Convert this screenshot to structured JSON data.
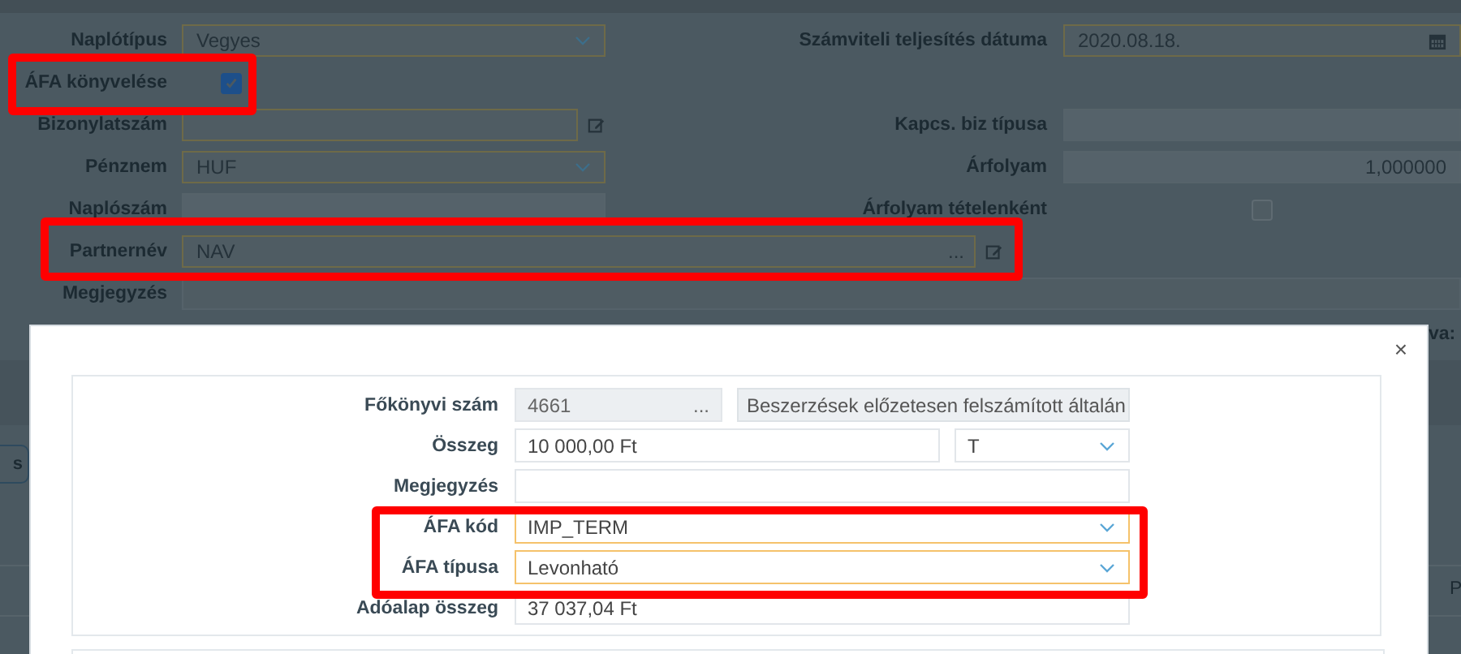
{
  "journal_form": {
    "rows": [
      {
        "left": {
          "label": "Naplótípus",
          "kind": "select",
          "value": "Vegyes"
        },
        "right": {
          "label": "Számviteli teljesítés dátuma",
          "kind": "date",
          "value": "2020.08.18."
        }
      },
      {
        "left": {
          "label": "ÁFA könyvelése",
          "kind": "checkbox",
          "checked": true
        }
      },
      {
        "left": {
          "label": "Bizonylatszám",
          "kind": "text",
          "edit_button": true
        },
        "right": {
          "label": "Kapcs. biz típusa",
          "kind": "readonly"
        }
      },
      {
        "left": {
          "label": "Pénznem",
          "kind": "select",
          "value": "HUF"
        },
        "right": {
          "label": "Árfolyam",
          "kind": "readonly",
          "value": "1,000000"
        }
      },
      {
        "left": {
          "label": "Naplószám",
          "kind": "readonly"
        },
        "right": {
          "label": "Árfolyam tételenként",
          "kind": "checkbox",
          "checked": false
        }
      },
      {
        "left": {
          "label": "Partnernév",
          "kind": "lookup",
          "value": "NAV",
          "ellipsis": "...",
          "edit_button": true
        }
      },
      {
        "left": {
          "label": "Megjegyzés",
          "kind": "note"
        }
      }
    ]
  },
  "background_fragments": {
    "label_fragment": "va:",
    "button_fragment": "s",
    "column_header_fragment": "P"
  },
  "modal": {
    "close": "×",
    "rows": [
      {
        "label": "Főkönyvi szám",
        "kind": "account",
        "value": "4661",
        "ellipsis": "...",
        "button": "Beszerzések előzetesen felszámított általán"
      },
      {
        "label": "Összeg",
        "kind": "amount",
        "value": "10 000,00 Ft",
        "side_value": "T"
      },
      {
        "label": "Megjegyzés",
        "kind": "text"
      },
      {
        "label": "ÁFA kód",
        "kind": "select",
        "value": "IMP_TERM",
        "required": true
      },
      {
        "label": "ÁFA típusa",
        "kind": "select",
        "value": "Levonható",
        "required": true
      },
      {
        "label": "Adóalap összeg",
        "kind": "text",
        "value": "37 037,04 Ft"
      }
    ]
  }
}
